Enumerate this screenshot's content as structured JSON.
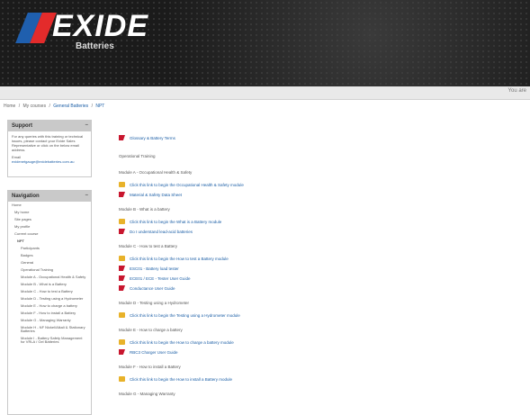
{
  "header": {
    "brand": "EXIDE",
    "sub": "Batteries"
  },
  "topbar": {
    "right_text": "You are"
  },
  "breadcrumb": {
    "items": [
      "Home",
      "My courses",
      "General Batteries",
      "NPT"
    ]
  },
  "support": {
    "title": "Support",
    "body": "For any queries with this training or technical issues, please contact your Exide Sales Representative or click on the below email address.",
    "email_label": "Email",
    "email": "exidenetgauge@exidebatteries.com.au"
  },
  "navigation": {
    "title": "Navigation",
    "items": [
      "Home",
      "My home",
      "Site pages",
      "My profile",
      "Current course",
      "NPT",
      "Participants",
      "Badges",
      "General",
      "Operational Training",
      "Module A - Occupational Health & Safety",
      "Module B - What is a Battery",
      "Module C - How to test a Battery",
      "Module D - Testing using a Hydrometer",
      "Module E - How to charge a battery",
      "Module F - How to install a Battery",
      "Module G - Managing Warranty",
      "Module H - NF Nickel/Alkali & Stationary Batteries",
      "Module I - Battery Safety Management for VRLA / Gel Batteries"
    ]
  },
  "main": {
    "rows": [
      {
        "kind": "link",
        "icon": "red",
        "text": "Glossary & Battery Terms"
      },
      {
        "kind": "head",
        "text": "Operational Training"
      },
      {
        "kind": "head",
        "text": "Module A - Occupational Health & Safety"
      },
      {
        "kind": "link",
        "icon": "fold",
        "text": "Click this link to begin the Occupational Health & Safety module"
      },
      {
        "kind": "link",
        "icon": "red",
        "text": "Material & Safety Data Sheet"
      },
      {
        "kind": "head",
        "text": "Module B - What is a battery"
      },
      {
        "kind": "link",
        "icon": "fold",
        "text": "Click this link to begin the What is a Battery module"
      },
      {
        "kind": "link",
        "icon": "red",
        "text": "Do I understand lead-acid batteries"
      },
      {
        "kind": "head",
        "text": "Module C - How to test a Battery"
      },
      {
        "kind": "link",
        "icon": "fold",
        "text": "Click this link to begin the How to test a Battery module"
      },
      {
        "kind": "link",
        "icon": "red",
        "text": "ESC01 - Battery load tester"
      },
      {
        "kind": "link",
        "icon": "red",
        "text": "ECE01 / ECE - Tester User Guide"
      },
      {
        "kind": "link",
        "icon": "red",
        "text": "Conductance User Guide"
      },
      {
        "kind": "head",
        "text": "Module D - Testing using a Hydrometer"
      },
      {
        "kind": "link",
        "icon": "fold",
        "text": "Click this link to begin the Testing using a Hydrometer module"
      },
      {
        "kind": "head",
        "text": "Module E - How to charge a battery"
      },
      {
        "kind": "link",
        "icon": "fold",
        "text": "Click this link to begin the How to charge a battery module"
      },
      {
        "kind": "link",
        "icon": "red",
        "text": "RBC3 Charger User Guide"
      },
      {
        "kind": "head",
        "text": "Module F - How to install a Battery"
      },
      {
        "kind": "link",
        "icon": "fold",
        "text": "Click this link to begin the How to install a Battery module"
      },
      {
        "kind": "head",
        "text": "Module G - Managing Warranty"
      }
    ]
  }
}
